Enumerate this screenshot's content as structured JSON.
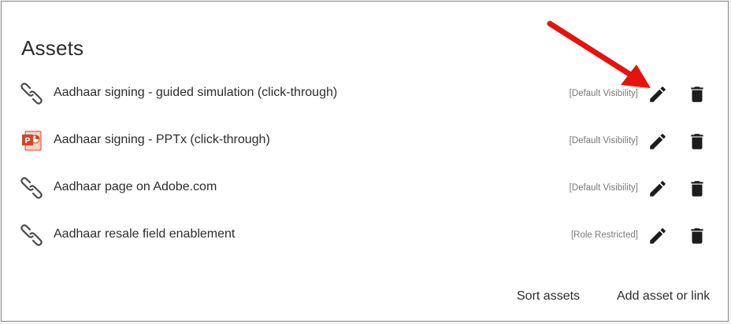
{
  "panel": {
    "title": "Assets"
  },
  "assets": [
    {
      "title": "Aadhaar signing - guided simulation (click-through)",
      "visibility": "[Default Visibility]",
      "icon": "link-icon"
    },
    {
      "title": "Aadhaar signing - PPTx (click-through)",
      "visibility": "[Default Visibility]",
      "icon": "powerpoint-file-icon"
    },
    {
      "title": "Aadhaar page on Adobe.com",
      "visibility": "[Default Visibility]",
      "icon": "link-icon"
    },
    {
      "title": "Aadhaar resale field enablement",
      "visibility": "[Role Restricted]",
      "icon": "link-icon"
    }
  ],
  "footer": {
    "sort_label": "Sort assets",
    "add_label": "Add asset or link"
  },
  "colors": {
    "annotation_arrow": "#e8120c",
    "powerpoint_brand": "#d24726",
    "text": "#2c2c2c",
    "muted_text": "#7a7a7a"
  }
}
